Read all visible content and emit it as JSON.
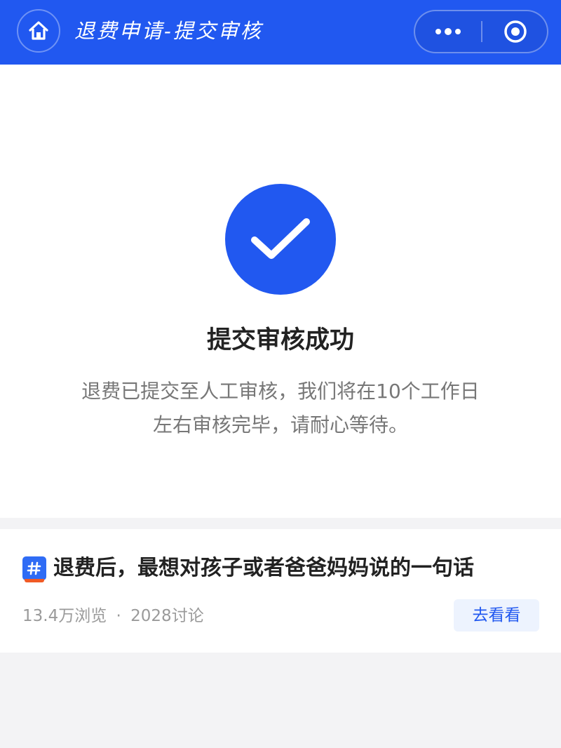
{
  "header": {
    "title": "退费申请-提交审核",
    "home_icon": "home-icon",
    "more_icon": "more-dots-icon",
    "close_icon": "target-close-icon",
    "bg_color": "#2158f0"
  },
  "result": {
    "icon": "check-circle-icon",
    "title": "提交审核成功",
    "desc_line1": "退费已提交至人工审核，我们将在10个工作日",
    "desc_line2": "左右审核完毕，请耐心等待。"
  },
  "topic": {
    "icon": "hashtag-icon",
    "title": "退费后，最想对孩子或者爸爸妈妈说的一句话",
    "views": "13.4万浏览",
    "separator": "·",
    "discussions": "2028讨论",
    "button_label": "去看看"
  }
}
